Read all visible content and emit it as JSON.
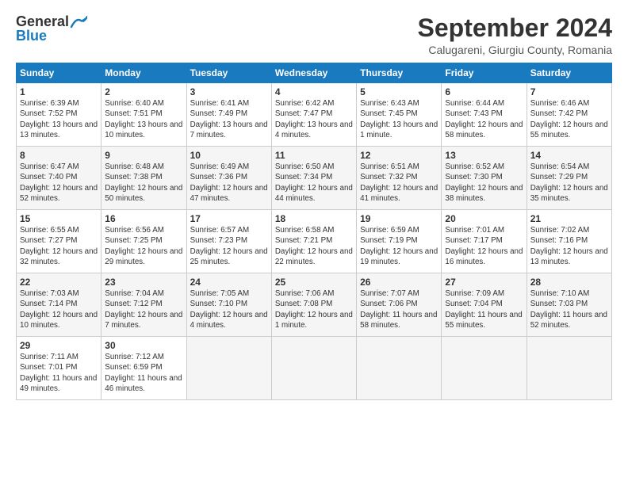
{
  "header": {
    "logo_general": "General",
    "logo_blue": "Blue",
    "month_title": "September 2024",
    "location": "Calugareni, Giurgiu County, Romania"
  },
  "weekdays": [
    "Sunday",
    "Monday",
    "Tuesday",
    "Wednesday",
    "Thursday",
    "Friday",
    "Saturday"
  ],
  "weeks": [
    [
      {
        "day": "1",
        "sunrise": "6:39 AM",
        "sunset": "7:52 PM",
        "daylight": "13 hours and 13 minutes."
      },
      {
        "day": "2",
        "sunrise": "6:40 AM",
        "sunset": "7:51 PM",
        "daylight": "13 hours and 10 minutes."
      },
      {
        "day": "3",
        "sunrise": "6:41 AM",
        "sunset": "7:49 PM",
        "daylight": "13 hours and 7 minutes."
      },
      {
        "day": "4",
        "sunrise": "6:42 AM",
        "sunset": "7:47 PM",
        "daylight": "13 hours and 4 minutes."
      },
      {
        "day": "5",
        "sunrise": "6:43 AM",
        "sunset": "7:45 PM",
        "daylight": "13 hours and 1 minute."
      },
      {
        "day": "6",
        "sunrise": "6:44 AM",
        "sunset": "7:43 PM",
        "daylight": "12 hours and 58 minutes."
      },
      {
        "day": "7",
        "sunrise": "6:46 AM",
        "sunset": "7:42 PM",
        "daylight": "12 hours and 55 minutes."
      }
    ],
    [
      {
        "day": "8",
        "sunrise": "6:47 AM",
        "sunset": "7:40 PM",
        "daylight": "12 hours and 52 minutes."
      },
      {
        "day": "9",
        "sunrise": "6:48 AM",
        "sunset": "7:38 PM",
        "daylight": "12 hours and 50 minutes."
      },
      {
        "day": "10",
        "sunrise": "6:49 AM",
        "sunset": "7:36 PM",
        "daylight": "12 hours and 47 minutes."
      },
      {
        "day": "11",
        "sunrise": "6:50 AM",
        "sunset": "7:34 PM",
        "daylight": "12 hours and 44 minutes."
      },
      {
        "day": "12",
        "sunrise": "6:51 AM",
        "sunset": "7:32 PM",
        "daylight": "12 hours and 41 minutes."
      },
      {
        "day": "13",
        "sunrise": "6:52 AM",
        "sunset": "7:30 PM",
        "daylight": "12 hours and 38 minutes."
      },
      {
        "day": "14",
        "sunrise": "6:54 AM",
        "sunset": "7:29 PM",
        "daylight": "12 hours and 35 minutes."
      }
    ],
    [
      {
        "day": "15",
        "sunrise": "6:55 AM",
        "sunset": "7:27 PM",
        "daylight": "12 hours and 32 minutes."
      },
      {
        "day": "16",
        "sunrise": "6:56 AM",
        "sunset": "7:25 PM",
        "daylight": "12 hours and 29 minutes."
      },
      {
        "day": "17",
        "sunrise": "6:57 AM",
        "sunset": "7:23 PM",
        "daylight": "12 hours and 25 minutes."
      },
      {
        "day": "18",
        "sunrise": "6:58 AM",
        "sunset": "7:21 PM",
        "daylight": "12 hours and 22 minutes."
      },
      {
        "day": "19",
        "sunrise": "6:59 AM",
        "sunset": "7:19 PM",
        "daylight": "12 hours and 19 minutes."
      },
      {
        "day": "20",
        "sunrise": "7:01 AM",
        "sunset": "7:17 PM",
        "daylight": "12 hours and 16 minutes."
      },
      {
        "day": "21",
        "sunrise": "7:02 AM",
        "sunset": "7:16 PM",
        "daylight": "12 hours and 13 minutes."
      }
    ],
    [
      {
        "day": "22",
        "sunrise": "7:03 AM",
        "sunset": "7:14 PM",
        "daylight": "12 hours and 10 minutes."
      },
      {
        "day": "23",
        "sunrise": "7:04 AM",
        "sunset": "7:12 PM",
        "daylight": "12 hours and 7 minutes."
      },
      {
        "day": "24",
        "sunrise": "7:05 AM",
        "sunset": "7:10 PM",
        "daylight": "12 hours and 4 minutes."
      },
      {
        "day": "25",
        "sunrise": "7:06 AM",
        "sunset": "7:08 PM",
        "daylight": "12 hours and 1 minute."
      },
      {
        "day": "26",
        "sunrise": "7:07 AM",
        "sunset": "7:06 PM",
        "daylight": "11 hours and 58 minutes."
      },
      {
        "day": "27",
        "sunrise": "7:09 AM",
        "sunset": "7:04 PM",
        "daylight": "11 hours and 55 minutes."
      },
      {
        "day": "28",
        "sunrise": "7:10 AM",
        "sunset": "7:03 PM",
        "daylight": "11 hours and 52 minutes."
      }
    ],
    [
      {
        "day": "29",
        "sunrise": "7:11 AM",
        "sunset": "7:01 PM",
        "daylight": "11 hours and 49 minutes."
      },
      {
        "day": "30",
        "sunrise": "7:12 AM",
        "sunset": "6:59 PM",
        "daylight": "11 hours and 46 minutes."
      },
      null,
      null,
      null,
      null,
      null
    ]
  ]
}
